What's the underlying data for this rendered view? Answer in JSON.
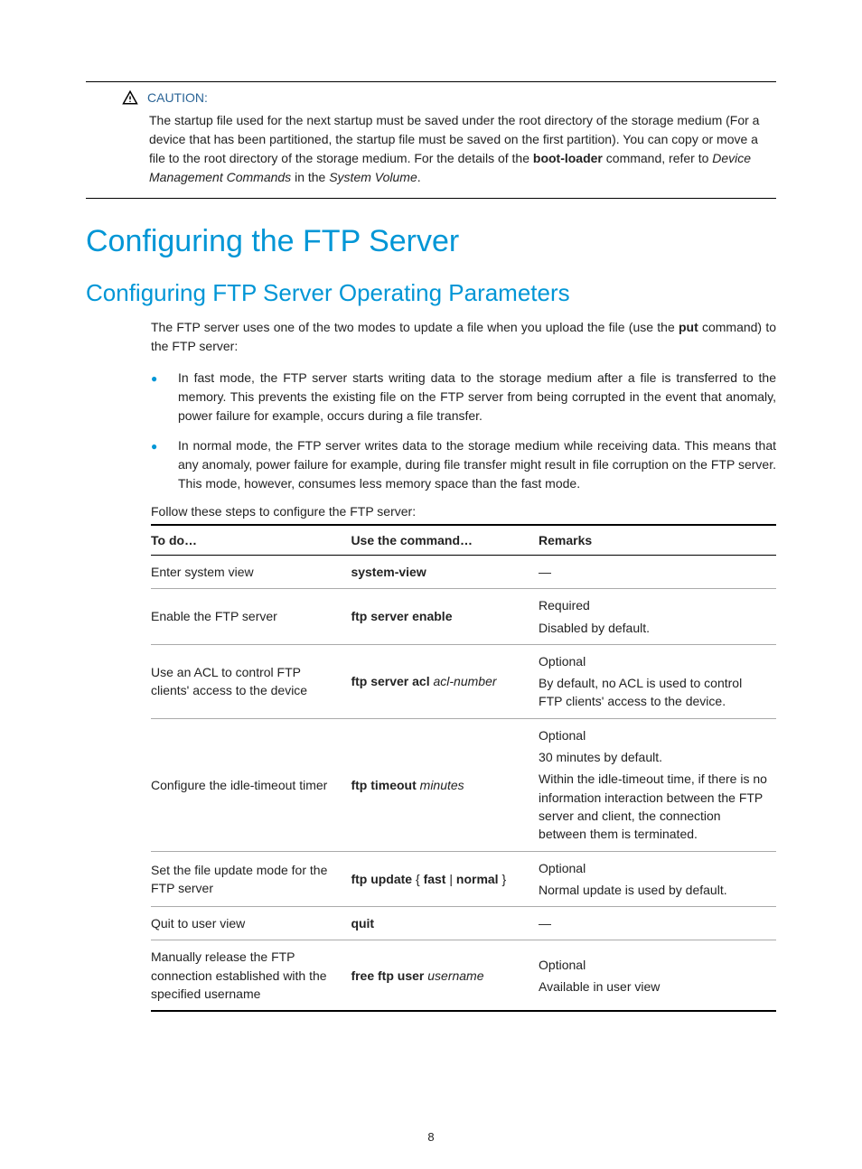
{
  "caution": {
    "label": "CAUTION:",
    "text_prefix": "The startup file used for the next startup must be saved under the root directory of the storage medium (For a device that has been partitioned, the startup file must be saved on the first partition). You can copy or move a file to the root directory of the storage medium. For the details of the ",
    "bold_cmd": "boot-loader",
    "text_mid": " command, refer to ",
    "italic1": "Device Management Commands",
    "text_in": " in the ",
    "italic2": "System Volume",
    "text_end": "."
  },
  "h1": "Configuring the FTP Server",
  "h2": "Configuring FTP Server Operating Parameters",
  "intro_prefix": "The FTP server uses one of the two modes to update a file when you upload the file (use the ",
  "intro_bold": "put",
  "intro_suffix": " command) to the FTP server:",
  "bullets": [
    "In fast mode, the FTP server starts writing data to the storage medium after a file is transferred to the memory. This prevents the existing file on the FTP server from being corrupted in the event that anomaly, power failure for example, occurs during a file transfer.",
    "In normal mode, the FTP server writes data to the storage medium while receiving data. This means that any anomaly, power failure for example, during file transfer might result in file corruption on the FTP server. This mode, however, consumes less memory space than the fast mode."
  ],
  "follow": "Follow these steps to configure the FTP server:",
  "table": {
    "headers": [
      "To do…",
      "Use the command…",
      "Remarks"
    ],
    "rows": [
      {
        "todo": "Enter system view",
        "cmd_bold": "system-view",
        "cmd_italic": "",
        "remarks": [
          "—"
        ]
      },
      {
        "todo": "Enable the FTP server",
        "cmd_bold": "ftp server enable",
        "cmd_italic": "",
        "remarks": [
          "Required",
          "Disabled by default."
        ]
      },
      {
        "todo": "Use an ACL to control FTP clients' access to the device",
        "cmd_bold": "ftp server acl",
        "cmd_italic": " acl-number",
        "remarks": [
          "Optional",
          "By default, no ACL is used to control FTP clients' access to the device."
        ]
      },
      {
        "todo": "Configure the idle-timeout timer",
        "cmd_bold": "ftp timeout",
        "cmd_italic": " minutes",
        "remarks": [
          "Optional",
          "30 minutes by default.",
          "Within the idle-timeout time, if there is no information interaction between the FTP server and client, the connection between them is terminated."
        ]
      },
      {
        "todo": "Set the file update mode for the FTP server",
        "cmd_bold": "ftp update",
        "cmd_mid": " { ",
        "cmd_bold2": "fast",
        "cmd_mid2": " | ",
        "cmd_bold3": "normal",
        "cmd_mid3": " }",
        "remarks": [
          "Optional",
          "Normal update is used by default."
        ]
      },
      {
        "todo": "Quit to user view",
        "cmd_bold": "quit",
        "cmd_italic": "",
        "remarks": [
          "—"
        ]
      },
      {
        "todo": "Manually release the FTP connection established with the specified username",
        "cmd_bold": "free ftp user",
        "cmd_italic": " username",
        "remarks": [
          "Optional",
          "Available in user view"
        ]
      }
    ]
  },
  "pageNumber": "8"
}
